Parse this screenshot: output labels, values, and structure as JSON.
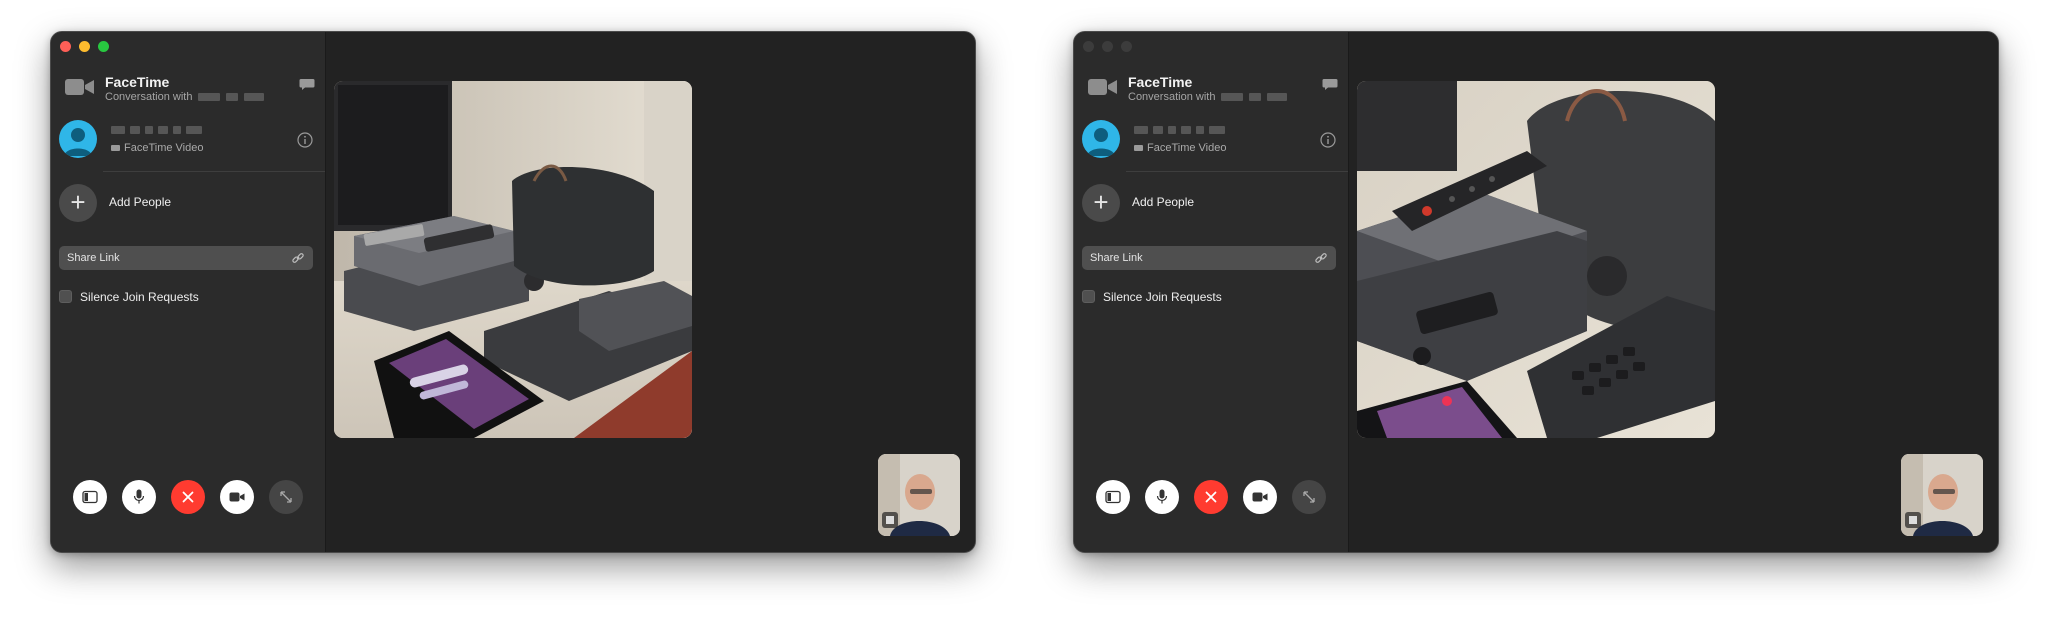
{
  "windows": [
    {
      "app": {
        "title": "FaceTime",
        "subtitle": "Conversation with"
      },
      "contact": {
        "status": "FaceTime Video"
      },
      "actions": {
        "add_people": "Add People",
        "share_link": "Share Link",
        "silence_join_requests": "Silence Join Requests"
      },
      "controls": [
        "sidebar-icon",
        "microphone-icon",
        "end-call-icon",
        "camera-icon",
        "fullscreen-icon"
      ],
      "video_subject": "desk-setup"
    },
    {
      "app": {
        "title": "FaceTime",
        "subtitle": "Conversation with"
      },
      "contact": {
        "status": "FaceTime Video"
      },
      "actions": {
        "add_people": "Add People",
        "share_link": "Share Link",
        "silence_join_requests": "Silence Join Requests"
      },
      "controls": [
        "sidebar-icon",
        "microphone-icon",
        "end-call-icon",
        "camera-icon",
        "fullscreen-icon"
      ],
      "video_subject": "desk-setup-zoomed"
    }
  ],
  "colors": {
    "end_call_red": "#ff3b30",
    "avatar_blue": "#2fb6e8",
    "close": "#fe5f57",
    "minimize": "#febc2e",
    "maximize": "#28c840"
  }
}
